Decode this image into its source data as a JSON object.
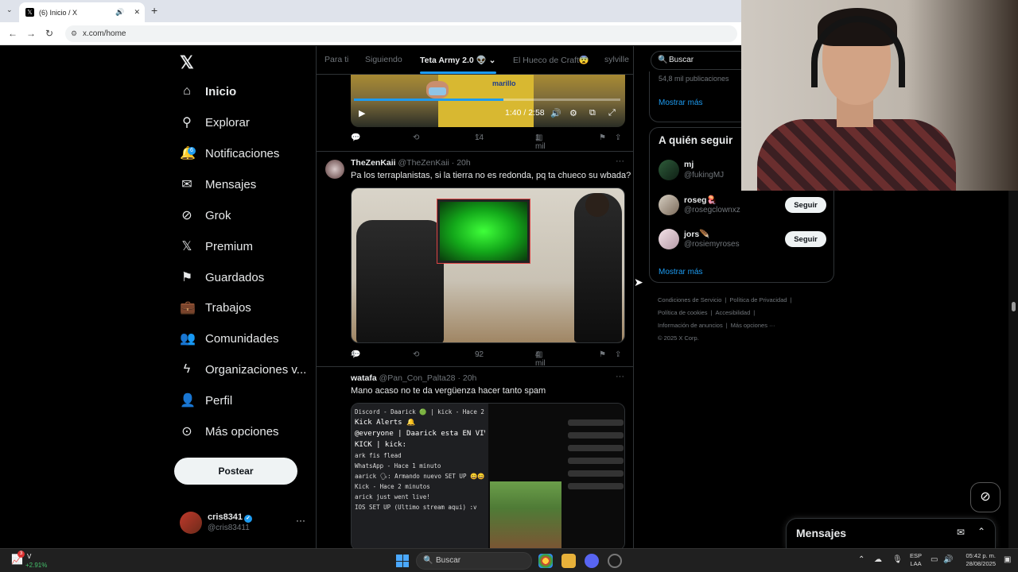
{
  "browser": {
    "tab_title": "(6) Inicio / X",
    "url": "x.com/home"
  },
  "sidebar": {
    "items": [
      {
        "label": "Inicio",
        "icon": "home-icon"
      },
      {
        "label": "Explorar",
        "icon": "search-icon"
      },
      {
        "label": "Notificaciones",
        "icon": "bell-icon",
        "badge": "6"
      },
      {
        "label": "Mensajes",
        "icon": "mail-icon"
      },
      {
        "label": "Grok",
        "icon": "grok-icon"
      },
      {
        "label": "Premium",
        "icon": "x-icon"
      },
      {
        "label": "Guardados",
        "icon": "bookmark-icon"
      },
      {
        "label": "Trabajos",
        "icon": "briefcase-icon"
      },
      {
        "label": "Comunidades",
        "icon": "people-icon"
      },
      {
        "label": "Organizaciones v...",
        "icon": "lightning-icon"
      },
      {
        "label": "Perfil",
        "icon": "person-icon"
      },
      {
        "label": "Más opciones",
        "icon": "more-circle-icon"
      }
    ],
    "post_button": "Postear",
    "profile": {
      "name": "cris8341",
      "handle": "@cris83411"
    }
  },
  "feed": {
    "tabs": [
      "Para ti",
      "Siguiendo",
      "Teta Army 2.0 👽",
      "El Hueco de Craft😨",
      "sylville"
    ],
    "video1": {
      "brand_text": "marillo",
      "time": "1:40 / 2:58",
      "progress": 0.56,
      "stats": {
        "reply": "",
        "repost": "",
        "like": "14",
        "views": "1 mil"
      }
    },
    "posts": [
      {
        "name": "TheZenKaii",
        "handle": "@TheZenKaii",
        "time": "· 20h",
        "text": "Pa los terraplanistas, si la tierra no es redonda, pq ta chueco su wbada?",
        "stats": {
          "reply": "4",
          "repost": "",
          "like": "92",
          "views": "4 mil"
        }
      },
      {
        "name": "watafa",
        "handle": "@Pan_Con_Palta28",
        "time": "· 20h",
        "text": "Mano acaso no te da vergüenza hacer tanto spam",
        "screenshot_lines": [
          "Discord - Daarick 🟢 | kick - Hace 2 minutos",
          "Kick Alerts 🔔",
          "@everyone | Daarick esta EN VIVO en",
          "KICK | kick:",
          "ark fis flead",
          "WhatsApp - Hace 1 minuto",
          "aarick 🗣: Armando nuevo SET UP 😄😄",
          "Kick - Hace 2 minutos",
          "arick just went live!",
          "IOS SET UP (Ultimo stream aqui) :v"
        ]
      }
    ]
  },
  "right": {
    "search_placeholder": "Buscar",
    "trend_count": "54,8 mil publicaciones",
    "show_more": "Mostrar más",
    "who_to_follow_title": "A quién seguir",
    "follow_label": "Seguir",
    "suggestions": [
      {
        "name": "mj",
        "handle": "@fukingMJ"
      },
      {
        "name": "roseg🪼",
        "handle": "@rosegclownxz"
      },
      {
        "name": "jors🪶",
        "handle": "@rosiemyroses"
      }
    ],
    "footer_links": [
      "Condiciones de Servicio",
      "|",
      "Política de Privacidad",
      "|",
      "Política de cookies",
      "|",
      "Accesibilidad",
      "|",
      "Información de anuncios",
      "|",
      "Más opciones ···",
      "© 2025 X Corp."
    ]
  },
  "messages_drawer": {
    "title": "Mensajes"
  },
  "taskbar": {
    "weather_label": "V",
    "weather_change": "+2.91%",
    "weather_badge": "3",
    "search": "Buscar",
    "lang_top": "ESP",
    "lang_bottom": "LAA",
    "time": "05:42 p. m.",
    "date": "28/08/2025"
  },
  "colors": {
    "accent": "#1d9bf0",
    "background": "#000000",
    "border": "#2f3336",
    "muted": "#71767b"
  }
}
